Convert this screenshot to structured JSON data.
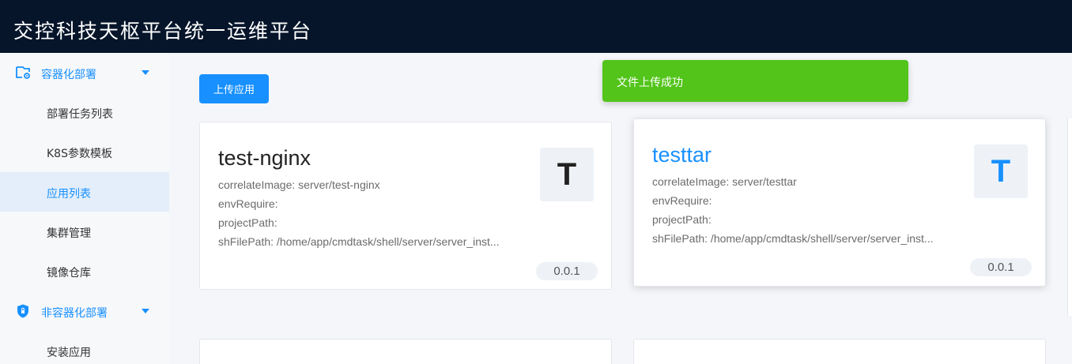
{
  "app": {
    "title": "交控科技天枢平台统一运维平台"
  },
  "sidebar": {
    "groups": [
      {
        "label": "容器化部署",
        "icon": "container-settings-icon"
      },
      {
        "label": "非容器化部署",
        "icon": "shield-icon"
      }
    ],
    "items": [
      {
        "label": "部署任务列表",
        "active": false
      },
      {
        "label": "K8S参数模板",
        "active": false
      },
      {
        "label": "应用列表",
        "active": true
      },
      {
        "label": "集群管理",
        "active": false
      },
      {
        "label": "镜像仓库",
        "active": false
      },
      {
        "label": "安装应用",
        "active": false
      }
    ]
  },
  "toolbar": {
    "upload_label": "上传应用"
  },
  "toast": {
    "message": "文件上传成功",
    "color": "#52c41a"
  },
  "cards": [
    {
      "name": "test-nginx",
      "letter": "T",
      "correlate": "correlateImage: server/test-nginx",
      "env": "envRequire:",
      "project": "projectPath:",
      "shfile": "shFilePath: /home/app/cmdtask/shell/server/server_inst...",
      "version": "0.0.1"
    },
    {
      "name": "testtar",
      "letter": "T",
      "correlate": "correlateImage: server/testtar",
      "env": "envRequire:",
      "project": "projectPath:",
      "shfile": "shFilePath: /home/app/cmdtask/shell/server/server_inst...",
      "version": "0.0.1"
    }
  ],
  "colors": {
    "accent": "#1890ff",
    "header_bg": "#06152a",
    "active_bg": "#e3eefa"
  }
}
